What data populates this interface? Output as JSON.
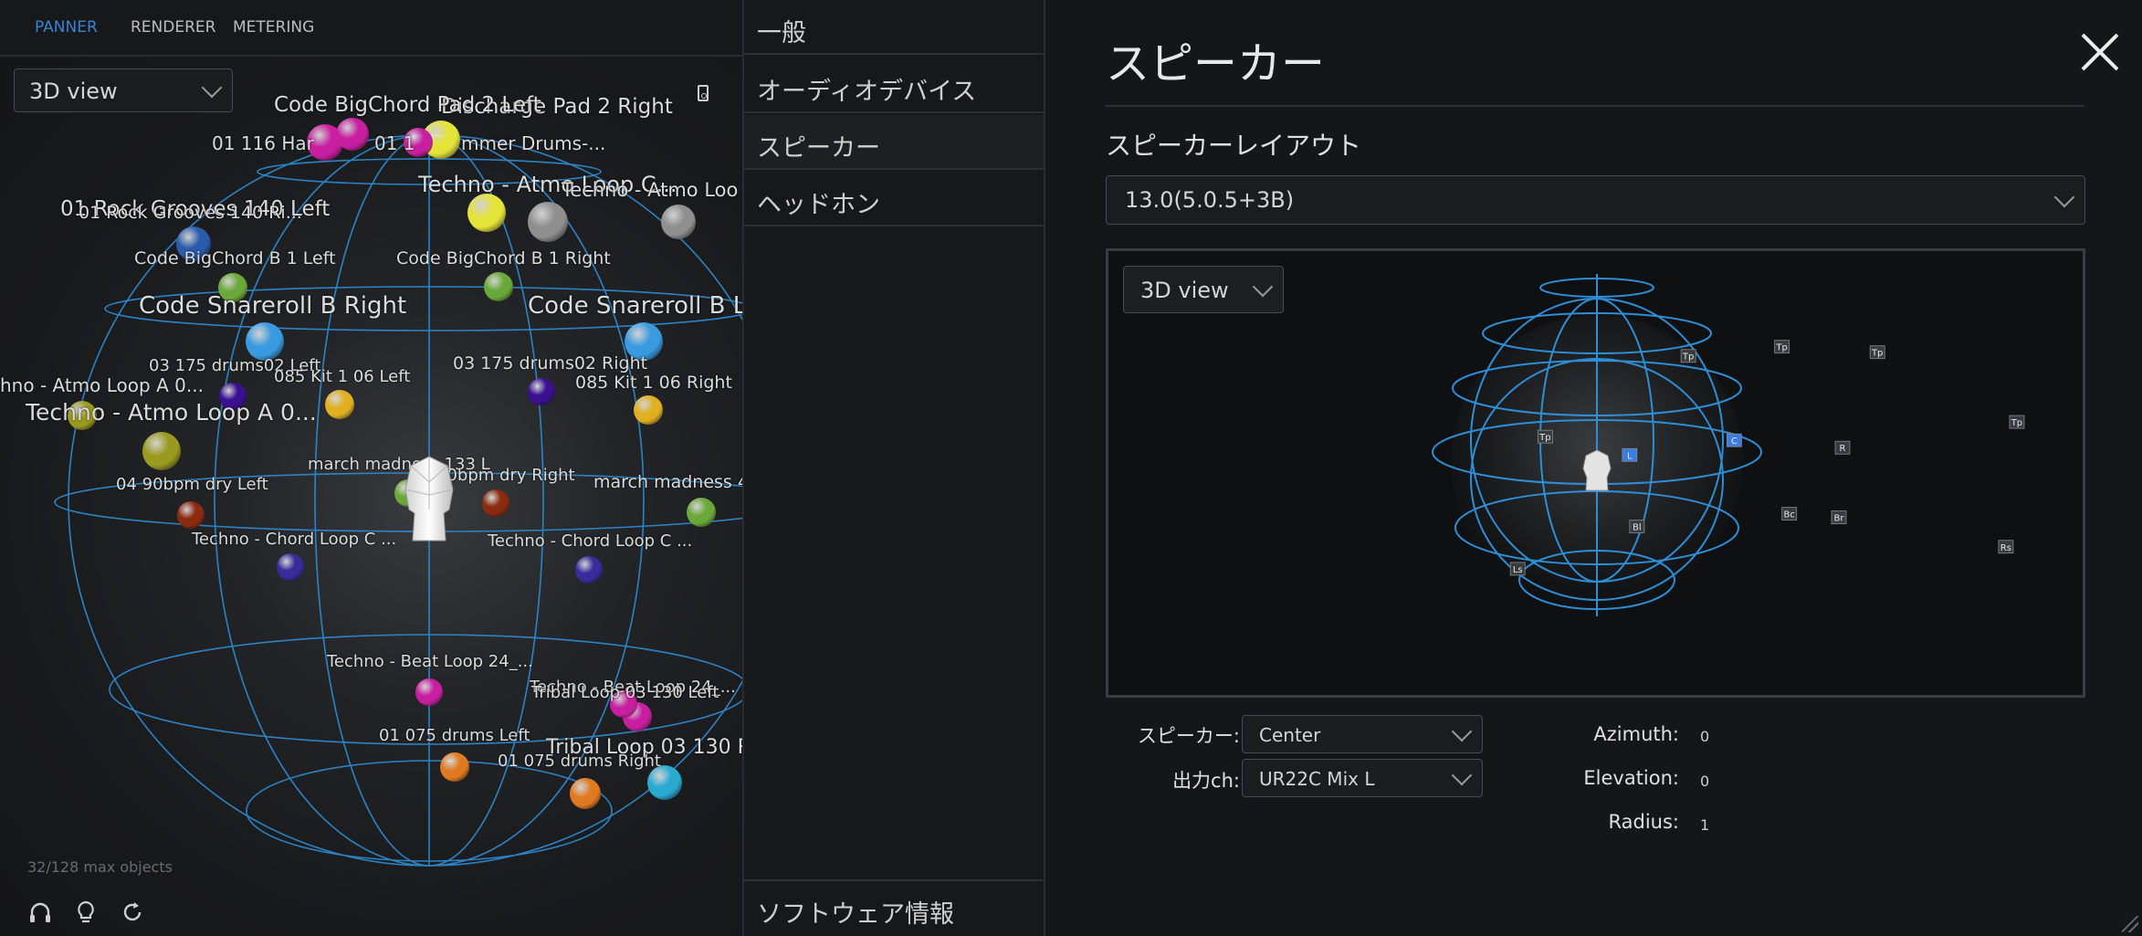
{
  "panner": {
    "tabs": [
      {
        "label": "PANNER",
        "active": true
      },
      {
        "label": "RENDERER",
        "active": false
      },
      {
        "label": "METERING",
        "active": false
      }
    ],
    "view_select": "3D view",
    "max_objects": "32/128 max objects",
    "objects": [
      {
        "label": "Discharge Pad 2 Right",
        "color": "#e3e33a"
      },
      {
        "label": "Code BigChord Pad 2 Left",
        "color": "#e3e33a"
      },
      {
        "label": "01 116 Har",
        "color": "#c81fa0"
      },
      {
        "label": "01 1",
        "color": "#c81fa0"
      },
      {
        "label": "mmer Drums-...",
        "color": "#c81fa0"
      },
      {
        "label": "Techno - Atmo Loop C...",
        "color": "#8f8f8f"
      },
      {
        "label": "Techno - Atmo Loo",
        "color": "#8f8f8f"
      },
      {
        "label": "01 Rock Grooves 140 Left",
        "color": "#2a5aaa"
      },
      {
        "label": "01 Rock Grooves 140 Ri...",
        "color": "#2a5aaa"
      },
      {
        "label": "Code BigChord B 1 Left",
        "color": "#6aa83a"
      },
      {
        "label": "Code BigChord B 1 Right",
        "color": "#6aa83a"
      },
      {
        "label": "Code Snareroll B Right",
        "color": "#3a9ae0"
      },
      {
        "label": "Code Snareroll B Le",
        "color": "#3a9ae0"
      },
      {
        "label": "03 175 drums02 Left",
        "color": "#3a1090"
      },
      {
        "label": "03 175 drums02 Right",
        "color": "#3a1090"
      },
      {
        "label": "085 Kit 1 06 Left",
        "color": "#e0b020"
      },
      {
        "label": "085 Kit 1 06 Right",
        "color": "#e0b020"
      },
      {
        "label": "hno - Atmo Loop A 0...",
        "color": "#9a9a20"
      },
      {
        "label": "Techno - Atmo Loop A 0...",
        "color": "#9a9a20"
      },
      {
        "label": "march madness 133 L",
        "color": "#6aa83a"
      },
      {
        "label": "march madness 4",
        "color": "#6aa83a"
      },
      {
        "label": "04 90bpm dry Left",
        "color": "#8a2a10"
      },
      {
        "label": "90bpm dry Right",
        "color": "#8a2a10"
      },
      {
        "label": "Techno - Chord Loop C ...",
        "color": "#3a2a9a"
      },
      {
        "label": "Techno - Chord Loop C ...",
        "color": "#3a2a9a"
      },
      {
        "label": "Techno - Beat Loop 24_...",
        "color": "#c81fa0"
      },
      {
        "label": "Techno - Beat Loop 24_...",
        "color": "#c81fa0"
      },
      {
        "label": "Tribal Loop 03 130 Left",
        "color": "#c81fa0"
      },
      {
        "label": "01 075 drums Left",
        "color": "#e07a20"
      },
      {
        "label": "01 075 drums Right",
        "color": "#e07a20"
      },
      {
        "label": "Tribal Loop 03 130 R",
        "color": "#2aaad0"
      }
    ],
    "bottom_icons": [
      "headphones-icon",
      "lightbulb-icon",
      "refresh-icon"
    ]
  },
  "nav": {
    "items": [
      {
        "label": "一般"
      },
      {
        "label": "オーディオデバイス"
      },
      {
        "label": "スピーカー",
        "selected": true
      },
      {
        "label": "ヘッドホン"
      }
    ],
    "about": "ソフトウェア情報"
  },
  "settings": {
    "title": "スピーカー",
    "layout_label": "スピーカーレイアウト",
    "layout_value": "13.0(5.0.5+3B)",
    "preview_view_select": "3D view",
    "speaker_tags": [
      "Tp",
      "Tp",
      "Tp",
      "Tp",
      "Tp",
      "L",
      "C",
      "R",
      "Ls",
      "Rs",
      "Bl",
      "Bc",
      "Br"
    ],
    "speaker_label": "スピーカー:",
    "speaker_value": "Center",
    "output_label": "出力ch:",
    "output_value": "UR22C Mix L",
    "azimuth_label": "Azimuth:",
    "azimuth_value": "0",
    "elevation_label": "Elevation:",
    "elevation_value": "0",
    "radius_label": "Radius:",
    "radius_value": "1"
  },
  "colors": {
    "accent": "#3a82d6",
    "grid": "#2e8ed6",
    "selected_speaker": "#3a7ee0"
  }
}
